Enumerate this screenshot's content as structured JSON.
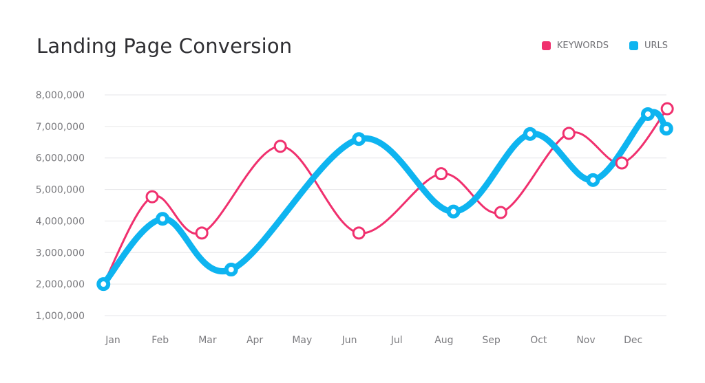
{
  "chart_data": {
    "type": "line",
    "title": "Landing Page Conversion",
    "xlabel": "",
    "ylabel": "",
    "categories": [
      "Jan",
      "Feb",
      "Mar",
      "Apr",
      "May",
      "Jun",
      "Jul",
      "Aug",
      "Sep",
      "Oct",
      "Nov",
      "Dec"
    ],
    "xlim": [
      -0.2,
      11.72
    ],
    "ylim": [
      1000000,
      8000000
    ],
    "yticks": [
      1000000,
      2000000,
      3000000,
      4000000,
      5000000,
      6000000,
      7000000,
      8000000
    ],
    "ytick_labels": [
      "1,000,000",
      "2,000,000",
      "3,000,000",
      "4,000,000",
      "5,000,000",
      "6,000,000",
      "7,000,000",
      "8,000,000"
    ],
    "grid": true,
    "legend_position": "top-right",
    "curve": "smooth",
    "series": [
      {
        "name": "KEYWORDS",
        "color": "#f0306e",
        "style": "thin",
        "x": [
          -0.2,
          0.83,
          1.88,
          3.54,
          5.2,
          6.94,
          8.2,
          9.64,
          10.76,
          11.72
        ],
        "values": [
          2000000,
          4770000,
          3620000,
          6370000,
          3620000,
          5500000,
          4270000,
          6780000,
          5840000,
          7560000
        ]
      },
      {
        "name": "URLS",
        "color": "#0eb4f0",
        "style": "thick",
        "x": [
          -0.2,
          1.05,
          2.5,
          5.2,
          7.2,
          8.82,
          10.15,
          11.31,
          11.7
        ],
        "values": [
          2000000,
          4070000,
          2460000,
          6600000,
          4300000,
          6760000,
          5300000,
          7390000,
          6930000
        ]
      }
    ]
  }
}
